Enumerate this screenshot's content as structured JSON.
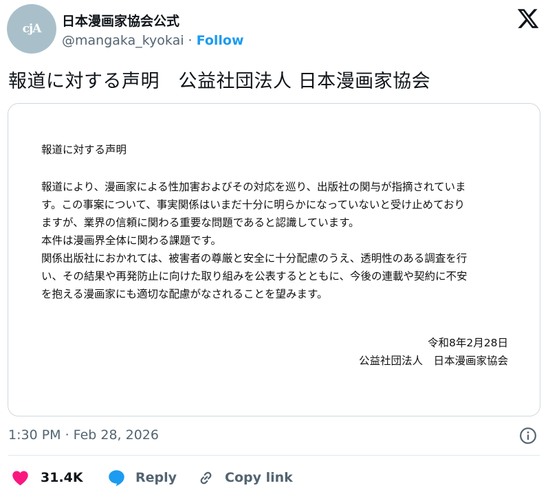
{
  "account": {
    "display_name": "日本漫画家協会公式",
    "handle": "@mangaka_kyokai",
    "separator": "·",
    "follow_label": "Follow",
    "avatar_text": "cjA"
  },
  "tweet": {
    "text": "報道に対する声明　公益社団法人 日本漫画家協会",
    "timestamp": "1:30 PM · Feb 28, 2026"
  },
  "document": {
    "title": "報道に対する声明",
    "lines": [
      "報道により、漫画家による性加害およびその対応を巡り、出版社の関与が指摘されていま",
      "す。この事案について、事実関係はいまだ十分に明らかになっていないと受け止めており",
      "ますが、業界の信頼に関わる重要な問題であると認識しています。",
      "本件は漫画界全体に関わる課題です。",
      "関係出版社におかれては、被害者の尊厳と安全に十分配慮のうえ、透明性のある調査を行",
      "い、その結果や再発防止に向けた取り組みを公表するとともに、今後の連載や契約に不安",
      "を抱える漫画家にも適切な配慮がなされることを望みます。"
    ],
    "date": "令和8年2月28日",
    "organization": "公益社団法人　日本漫画家協会"
  },
  "actions": {
    "like_count": "31.4K",
    "reply_label": "Reply",
    "copy_link_label": "Copy link"
  },
  "icons": {
    "brand_logo": "x-logo-icon",
    "info": "info-icon",
    "like": "heart-icon",
    "reply": "speech-bubble-icon",
    "copy": "link-icon"
  },
  "colors": {
    "accent": "#1d9bf0",
    "like": "#f91880",
    "secondary_text": "#536471",
    "avatar_bg": "#a9c0cb"
  }
}
